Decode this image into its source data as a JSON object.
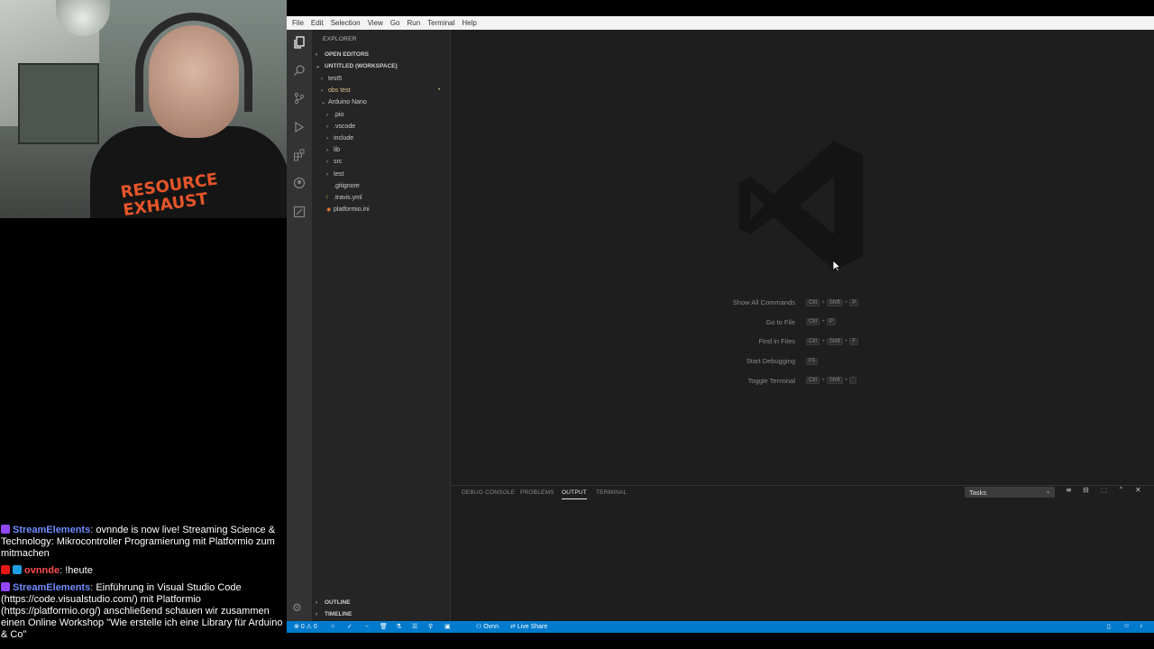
{
  "chat": {
    "messages": [
      {
        "user": "StreamElements",
        "text": "ovnnde is now live! Streaming Science & Technology: Mikrocontroller Programierung mit Platformio zum mitmachen"
      },
      {
        "user": "ovnnde",
        "text": "!heute"
      },
      {
        "user": "StreamElements",
        "text": "Einführung in Visual Studio Code (https://code.visualstudio.com/) mit Platformio (https://platformio.org/) anschließend schauen wir zusammen einen Online Workshop \"Wie erstelle ich eine Library für Arduino & Co\""
      }
    ]
  },
  "webcam": {
    "shirt_text_1": "RESOURCE",
    "shirt_text_2": "EXHAUST"
  },
  "menubar": [
    "File",
    "Edit",
    "Selection",
    "View",
    "Go",
    "Run",
    "Terminal",
    "Help"
  ],
  "sidebar": {
    "title": "EXPLORER",
    "open_editors": "OPEN EDITORS",
    "workspace": "UNTITLED (WORKSPACE)",
    "items": {
      "test5": "test5",
      "obs_test": "obs test",
      "arduino_nano": "Arduino Nano",
      "pio": ".pio",
      "vscode": ".vscode",
      "include": "include",
      "lib": "lib",
      "src": "src",
      "test": "test",
      "gitignore": ".gitignore",
      "travis": ".travis.yml",
      "platformio": "platformio.ini"
    },
    "modified_marker": "•",
    "outline": "OUTLINE",
    "timeline": "TIMELINE"
  },
  "shortcuts": [
    {
      "label": "Show All Commands",
      "keys": [
        "Ctrl",
        "+",
        "Shift",
        "+",
        "P"
      ]
    },
    {
      "label": "Go to File",
      "keys": [
        "Ctrl",
        "+",
        "P"
      ]
    },
    {
      "label": "Find in Files",
      "keys": [
        "Ctrl",
        "+",
        "Shift",
        "+",
        "F"
      ]
    },
    {
      "label": "Start Debugging",
      "keys": [
        "F5"
      ]
    },
    {
      "label": "Toggle Terminal",
      "keys": [
        "Ctrl",
        "+",
        "Shift",
        "+",
        "`"
      ]
    }
  ],
  "panel": {
    "tabs": {
      "debug": "DEBUG CONSOLE",
      "problems": "PROBLEMS",
      "output": "OUTPUT",
      "terminal": "TERMINAL"
    },
    "select": "Tasks"
  },
  "status": {
    "errors": "0",
    "warnings": "0",
    "user": "Ovnn",
    "live_share": "Live Share"
  },
  "colors": {
    "accent": "#007acc",
    "modified": "#e2c08d",
    "editor_bg": "#1e1e1e"
  }
}
